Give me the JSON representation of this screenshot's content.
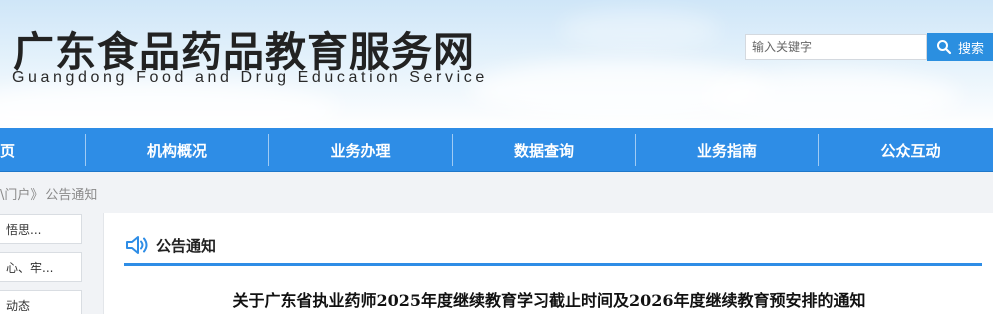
{
  "header": {
    "title_cn": "广东食品药品教育服务网",
    "title_en": "Guangdong Food and Drug Education Service"
  },
  "search": {
    "placeholder": "输入关键字",
    "button_label": "搜索"
  },
  "nav": {
    "items": [
      {
        "label": "页"
      },
      {
        "label": "机构概况"
      },
      {
        "label": "业务办理"
      },
      {
        "label": "数据查询"
      },
      {
        "label": "业务指南"
      },
      {
        "label": "公众互动"
      }
    ]
  },
  "breadcrumb": {
    "parent": "\\门户",
    "separator": "》",
    "current": "公告通知"
  },
  "sidebar": {
    "items": [
      {
        "label": "悟思..."
      },
      {
        "label": "心、牢..."
      },
      {
        "label": "动态"
      }
    ]
  },
  "main": {
    "section_title": "公告通知",
    "article_title": "关于广东省执业药师2025年度继续教育学习截止时间及2026年度继续教育预安排的通知"
  },
  "colors": {
    "nav_bg": "#2e8de6",
    "accent": "#2b8fe0"
  }
}
